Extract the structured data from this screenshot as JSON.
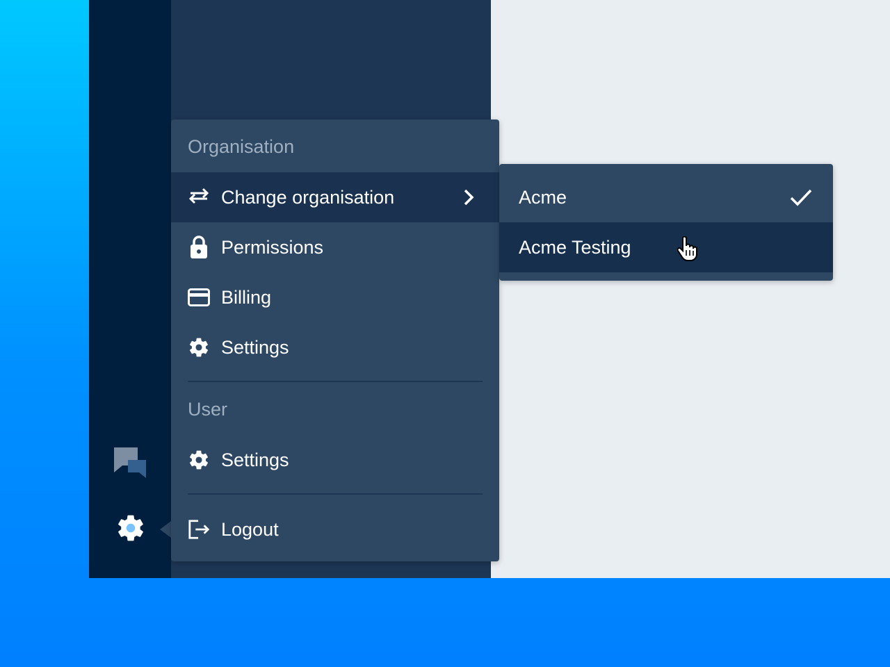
{
  "rail": {
    "icons": [
      "chat-icon",
      "gear-icon"
    ],
    "active_color": "#79c3ff"
  },
  "menu": {
    "organisation_heading": "Organisation",
    "items": [
      {
        "label": "Change organisation",
        "icon": "swap-arrows-icon",
        "has_submenu": true,
        "active": true
      },
      {
        "label": "Permissions",
        "icon": "lock-icon"
      },
      {
        "label": "Billing",
        "icon": "credit-card-icon"
      },
      {
        "label": "Settings",
        "icon": "gear-icon"
      }
    ],
    "user_heading": "User",
    "user_items": [
      {
        "label": "Settings",
        "icon": "gear-icon"
      }
    ],
    "logout_label": "Logout"
  },
  "submenu": {
    "items": [
      {
        "label": "Acme",
        "selected": true
      },
      {
        "label": "Acme Testing",
        "hovered": true
      }
    ]
  },
  "colors": {
    "menu_bg": "#2e4762",
    "active_bg": "#1a324f",
    "rail_bg": "#001f3f",
    "panel_bg": "#1d3654",
    "heading_text": "#9fb0c2"
  }
}
